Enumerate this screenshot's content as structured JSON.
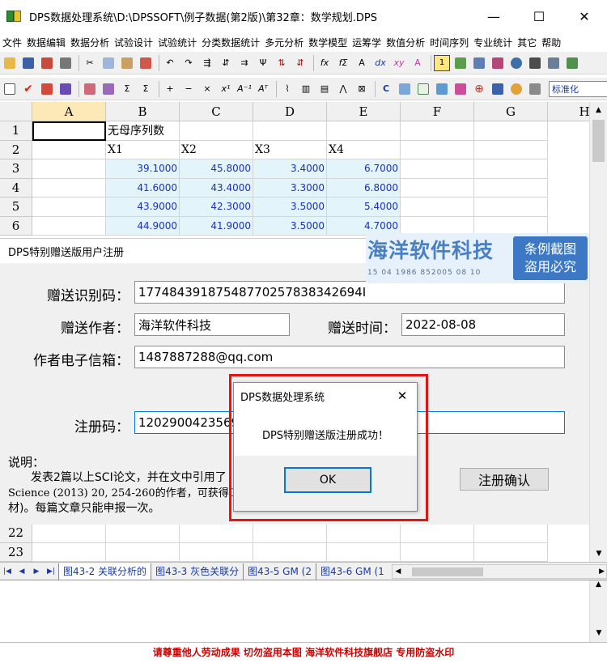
{
  "window": {
    "title": "DPS数据处理系统\\D:\\DPSSOFT\\例子数据(第2版)\\第32章：数学规划.DPS",
    "minimize": "—",
    "maximize": "☐",
    "close": "✕"
  },
  "menu": [
    "文件",
    "数据编辑",
    "数据分析",
    "试验设计",
    "试验统计",
    "分类数据统计",
    "多元分析",
    "数学模型",
    "运筹学",
    "数值分析",
    "时间序列",
    "专业统计",
    "其它",
    "帮助"
  ],
  "toolbar2_select": "标准化",
  "sheet": {
    "columns": [
      "A",
      "B",
      "C",
      "D",
      "E",
      "F",
      "G",
      "H"
    ],
    "visible_rows": [
      "1",
      "2",
      "3",
      "4",
      "5",
      "6"
    ],
    "bottom_rows": [
      "22",
      "23"
    ],
    "cells": {
      "B1": "无母序列数",
      "B2": "X1",
      "C2": "X2",
      "D2": "X3",
      "E2": "X4",
      "B3": "39.1000",
      "C3": "45.8000",
      "D3": "3.4000",
      "E3": "6.7000",
      "B4": "41.6000",
      "C4": "43.4000",
      "D4": "3.3000",
      "E4": "6.8000",
      "B5": "43.9000",
      "C5": "42.3000",
      "D5": "3.5000",
      "E5": "5.4000",
      "B6": "44.9000",
      "C6": "41.9000",
      "D6": "3.5000",
      "E6": "4.7000"
    }
  },
  "tabs": [
    "图43-2 关联分析的",
    "图43-3 灰色关联分",
    "图43-5 GM (2",
    "图43-6 GM (1"
  ],
  "registration": {
    "title": "DPS特别赠送版用户注册",
    "id_label": "赠送识别码：",
    "id_value": "17748439187548770257838342694I",
    "author_label": "赠送作者：",
    "author_value": "海洋软件科技",
    "time_label": "赠送时间：",
    "time_value": "2022-08-08",
    "email_label": "作者电子信箱：",
    "email_value": "1487887288@qq.com",
    "code_label": "注册码：",
    "code_value": "12029004235694",
    "confirm_button": "注册确认",
    "note_heading": "说明：",
    "note_line1": "发表2篇以上SCI论文，并在文中引用了",
    "note_line2": "Science (2013) 20, 254-260的作者，可获得D",
    "note_line3": "材)。每篇文章只能申报一次。"
  },
  "watermark": {
    "brand": "海洋软件科技",
    "code": "15 04 1986 852005 08 10",
    "stamp_line1": "条例截图",
    "stamp_line2": "盗用必究",
    "bottom": "请尊重他人劳动成果    切勿盗用本图    海洋软件科技旗舰店    专用防盗水印"
  },
  "messagebox": {
    "title": "DPS数据处理系统",
    "close": "✕",
    "message": "DPS特别赠送版注册成功！",
    "ok_label": "OK"
  },
  "accent_colors": {
    "highlight_red": "#e21414",
    "focus_blue": "#0078d7",
    "number_blue": "#1a30c0"
  }
}
